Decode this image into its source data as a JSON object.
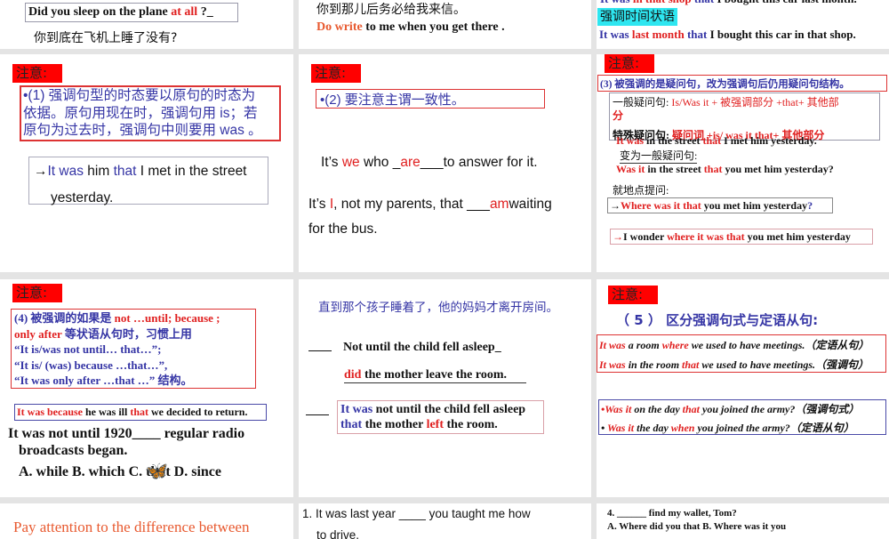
{
  "colors": {
    "accent_red": "#e02020",
    "accent_blue": "#3535a5",
    "label_bg": "#ff0000",
    "highlight_cyan": "#2ee6f0"
  },
  "s0": {
    "q": [
      [
        "Did you sleep on the plane ",
        "k"
      ],
      [
        "at all",
        "r"
      ],
      [
        "   ?_",
        "k"
      ]
    ],
    "cn": [
      [
        "你到底在飞机上睡了没有?",
        "k"
      ]
    ]
  },
  "s1": {
    "cn": [
      [
        "你到那儿后务必给我来信。",
        "k"
      ]
    ],
    "en": [
      [
        "Do write",
        "o"
      ],
      [
        " to me when you get there .",
        "k"
      ]
    ]
  },
  "s2": {
    "top": [
      [
        "It was ",
        "b"
      ],
      [
        "in that shop",
        "r"
      ],
      [
        " that",
        "b"
      ],
      [
        " I bought this car last month.",
        "k"
      ]
    ],
    "tag": "强调时间状语",
    "en": [
      [
        "It was ",
        "b"
      ],
      [
        "last month",
        "r"
      ],
      [
        " that",
        "b"
      ],
      [
        " I bought this car in  that shop.",
        "k"
      ]
    ]
  },
  "s3": {
    "label": "注意:",
    "rule": [
      [
        [
          "•(1)  强调句型的时态要以原句的时态为",
          "b"
        ]
      ],
      [
        [
          "依据。原句用现在时，强调句用 is；若",
          "b"
        ]
      ],
      [
        [
          "原句为过去时，强调句中则要用 was 。",
          "b"
        ]
      ]
    ],
    "ex": [
      [
        [
          "→",
          "k"
        ],
        [
          "It was",
          "b"
        ],
        [
          " him ",
          "k"
        ],
        [
          "that",
          "b"
        ],
        [
          " I met in the street",
          "k"
        ]
      ],
      [
        [
          "yesterday.",
          "k"
        ]
      ]
    ]
  },
  "s4": {
    "label": "注意:",
    "rule": [
      [
        "•(2) 要注意主谓一致性。",
        "b"
      ]
    ],
    "ex1": [
      [
        "It’s ",
        "k"
      ],
      [
        "we",
        "r"
      ],
      [
        " who _",
        "k"
      ],
      [
        "are",
        "r"
      ],
      [
        "___to answer for it.",
        "k"
      ]
    ],
    "ex2": [
      [
        "It’s ",
        "k"
      ],
      [
        "I",
        "r"
      ],
      [
        ", not my parents, that ___",
        "k"
      ],
      [
        "am",
        "r"
      ],
      [
        "waiting",
        "k"
      ]
    ],
    "ex3": [
      [
        "for the bus.",
        "k"
      ]
    ]
  },
  "s5": {
    "label": "注意:",
    "rule": [
      [
        "(3) 被强调的是疑问句，改为强调句后仍用疑问句结构。",
        "b"
      ]
    ],
    "g1": [
      [
        "一般疑问句:  ",
        "k"
      ],
      [
        "Is/Was it + 被强调部分 +that+ 其他部",
        "r"
      ]
    ],
    "g1b": [
      [
        "分",
        "r"
      ]
    ],
    "g2": [
      [
        "特殊疑问句: ",
        "k"
      ],
      [
        "疑问词 +is/ was it that+ 其他部分",
        "r"
      ]
    ],
    "ex": [
      [
        "It was",
        "r"
      ],
      [
        " in the street  ",
        "k"
      ],
      [
        "that",
        "r"
      ],
      [
        " I met him yesterday.",
        "k"
      ]
    ],
    "c1": [
      [
        "变为一般疑问句:",
        "k"
      ]
    ],
    "ex2": [
      [
        "Was it",
        "r"
      ],
      [
        " in the street ",
        "k"
      ],
      [
        "that",
        "r"
      ],
      [
        " you met him yesterday?",
        "k"
      ]
    ],
    "c2": [
      [
        "就地点提问:",
        "k"
      ]
    ],
    "ex3": [
      [
        "→",
        "k"
      ],
      [
        "Where was it that",
        "r"
      ],
      [
        " you  met him yesterday",
        "k"
      ],
      [
        "?",
        "b"
      ]
    ],
    "ex4": [
      [
        "→",
        "r"
      ],
      [
        "I wonder  ",
        "k"
      ],
      [
        "where it was that",
        "r"
      ],
      [
        " you met him yesterday",
        "k"
      ]
    ]
  },
  "s6": {
    "label": "注意:",
    "rule": [
      [
        [
          "(4)  被强调的如果是 ",
          "b"
        ],
        [
          "not …until; because ;",
          "r"
        ]
      ],
      [
        [
          "only after",
          "r"
        ],
        [
          " 等状语从句时，习惯上用",
          "b"
        ]
      ],
      [
        [
          "“It is/was not until… that…”;",
          "b"
        ]
      ],
      [
        [
          "“It is/ (was) because …that…”,",
          "b"
        ]
      ],
      [
        [
          "“It was only after …that …” 结构。",
          "b"
        ]
      ]
    ],
    "ex": [
      [
        "It was because",
        "r"
      ],
      [
        " he was ill ",
        "k"
      ],
      [
        "that",
        "r"
      ],
      [
        " we decided to return.",
        "k"
      ]
    ],
    "q1": [
      [
        "It was not until 1920____ regular radio",
        "k"
      ]
    ],
    "q2": [
      [
        "broadcasts began.",
        "k"
      ]
    ],
    "opts": [
      [
        "A. while   B. which   C. that   D. since",
        "k"
      ]
    ]
  },
  "s7": {
    "cn": [
      [
        "直到那个孩子睡着了，他的妈妈才离开房间。",
        "b"
      ]
    ],
    "a1": [
      [
        "Not until the child fell asleep_",
        "k"
      ]
    ],
    "a2": [
      [
        "did",
        "r"
      ],
      [
        " the mother leave the room.",
        "k"
      ]
    ],
    "b1": [
      [
        "It was",
        "b"
      ],
      [
        "  not until the child fell asleep",
        "k"
      ]
    ],
    "b2": [
      [
        "that",
        "b"
      ],
      [
        " the mother ",
        "k"
      ],
      [
        "left",
        "r"
      ],
      [
        " the room.",
        "k"
      ]
    ]
  },
  "s8": {
    "label": "注意:",
    "head": [
      [
        "（ 5 ）  区分强调句式与定语从句:",
        "b"
      ]
    ],
    "r1": [
      [
        "It was",
        "r"
      ],
      [
        " a room ",
        "k"
      ],
      [
        "where",
        "r"
      ],
      [
        " we used to have meetings.（定语从句）",
        "k"
      ]
    ],
    "r2": [
      [
        "It was",
        "r"
      ],
      [
        " in the room ",
        "k"
      ],
      [
        "that",
        "r"
      ],
      [
        " we used to have meetings.（强调句）",
        "k"
      ]
    ],
    "b1": [
      [
        "•Was it",
        "r"
      ],
      [
        " on the day ",
        "k"
      ],
      [
        "that",
        "r"
      ],
      [
        " you joined the army?（强调句式）",
        "k"
      ]
    ],
    "b2": [
      [
        "• ",
        "k"
      ],
      [
        "Was it",
        "r"
      ],
      [
        " the day ",
        "k"
      ],
      [
        "when",
        "r"
      ],
      [
        " you joined the army?（定语从句）",
        "k"
      ]
    ]
  },
  "s9": {
    "title": [
      [
        "Pay attention to the difference between",
        "o"
      ]
    ]
  },
  "s10": {
    "q": [
      [
        "1. It was last year ____ you taught me how",
        "k"
      ]
    ],
    "q2": [
      [
        "to drive.",
        "k"
      ]
    ]
  },
  "s11": {
    "q": [
      [
        "4. ______ find my wallet, Tom?",
        "k"
      ]
    ],
    "opts": [
      [
        "A. Where did you that     B. Where was it you",
        "k"
      ]
    ]
  }
}
